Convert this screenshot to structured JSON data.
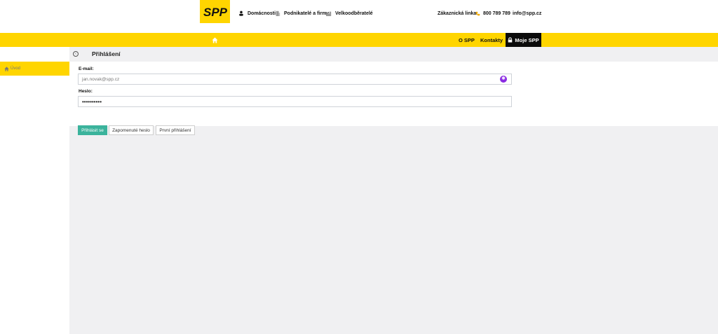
{
  "header": {
    "logo_text": "SPP",
    "segments": [
      {
        "label": "Domácnosti",
        "icon": "person-icon"
      },
      {
        "label": "Podnikatelé a firmy",
        "icon": "building-icon"
      },
      {
        "label": "Velkoodběratelé",
        "icon": "factory-icon"
      }
    ],
    "hotline_label": "Zákaznická linka:",
    "phone": "800 789 789",
    "email": "info@spp.cz"
  },
  "nav": {
    "home_icon": "home-icon",
    "links": [
      "O SPP",
      "Kontakty"
    ],
    "account_label": "Moje SPP"
  },
  "sidebar": {
    "items": [
      {
        "label": "Úvod",
        "icon": "home-icon"
      }
    ]
  },
  "page": {
    "title": "Přihlášení",
    "email_label": "E-mail:",
    "email_value": "jan.novak@spp.cz",
    "password_label": "Heslo:",
    "password_value": "••••••••••",
    "buttons": {
      "login": "Přihlásit se",
      "forgot": "Zapomenuté heslo",
      "first": "První přihlášení"
    }
  },
  "colors": {
    "brand_yellow": "#ffd500",
    "dark": "#0b0b0b",
    "primary_button": "#3bb39c",
    "background": "#f0f0f2"
  }
}
